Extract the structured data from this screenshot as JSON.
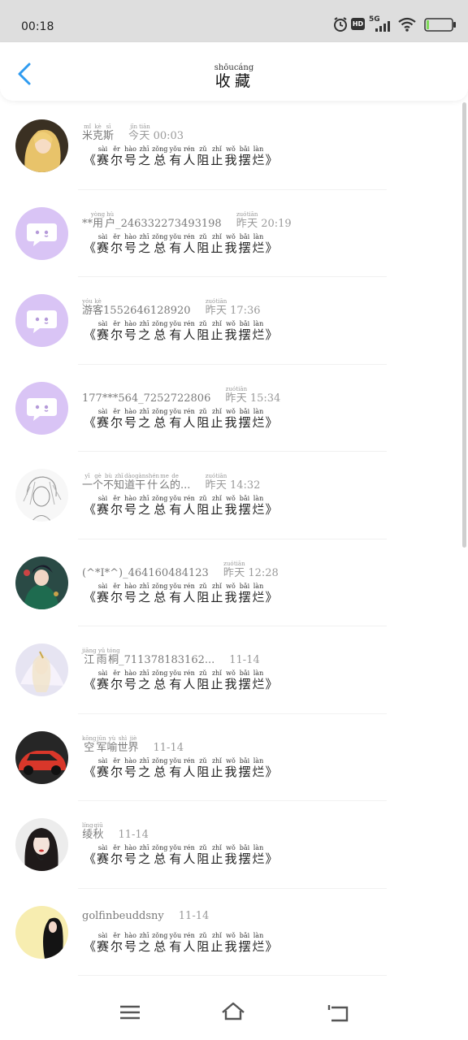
{
  "status_bar": {
    "time": "00:18",
    "icons": [
      "alarm-icon",
      "hd-icon",
      "signal-5g-icon",
      "wifi-icon",
      "battery-icon"
    ],
    "network": "5G",
    "hd": "HD"
  },
  "header": {
    "title_chars": [
      {
        "char": "收",
        "pinyin": "shōu"
      },
      {
        "char": "藏",
        "pinyin": "cáng"
      }
    ]
  },
  "book_title": {
    "open": "《",
    "close": "》",
    "chars": [
      {
        "char": "赛",
        "pinyin": "sài"
      },
      {
        "char": "尔",
        "pinyin": "ěr"
      },
      {
        "char": "号",
        "pinyin": "hào"
      },
      {
        "char": "之",
        "pinyin": "zhī"
      },
      {
        "char": "总",
        "pinyin": "zǒng"
      },
      {
        "char": "有",
        "pinyin": "yǒu"
      },
      {
        "char": "人",
        "pinyin": "rén"
      },
      {
        "char": "阻",
        "pinyin": "zǔ"
      },
      {
        "char": "止",
        "pinyin": "zhǐ"
      },
      {
        "char": "我",
        "pinyin": "wǒ"
      },
      {
        "char": "摆",
        "pinyin": "bǎi"
      },
      {
        "char": "烂",
        "pinyin": "làn"
      }
    ]
  },
  "items": [
    {
      "avatar": "blonde-girl",
      "name": [
        {
          "t": "米",
          "p": "mǐ"
        },
        {
          "t": "克",
          "p": "kè"
        },
        {
          "t": "斯",
          "p": "sī"
        }
      ],
      "time": [
        {
          "t": "今",
          "p": "jīn"
        },
        {
          "t": "天",
          "p": "tiān"
        },
        {
          "t": " 00:03",
          "p": ""
        }
      ]
    },
    {
      "avatar": "default",
      "name": [
        {
          "t": "**",
          "p": ""
        },
        {
          "t": "用",
          "p": "yòng"
        },
        {
          "t": "户",
          "p": "hù"
        },
        {
          "t": "_246332273493198",
          "p": ""
        }
      ],
      "time": [
        {
          "t": "昨",
          "p": "zuó"
        },
        {
          "t": "天",
          "p": "tiān"
        },
        {
          "t": " 20:19",
          "p": ""
        }
      ]
    },
    {
      "avatar": "default",
      "name": [
        {
          "t": "游",
          "p": "yóu"
        },
        {
          "t": "客",
          "p": "kè"
        },
        {
          "t": "1552646128920",
          "p": ""
        }
      ],
      "time": [
        {
          "t": "昨",
          "p": "zuó"
        },
        {
          "t": "天",
          "p": "tiān"
        },
        {
          "t": " 17:36",
          "p": ""
        }
      ]
    },
    {
      "avatar": "default",
      "name": [
        {
          "t": "177***564_7252722806",
          "p": ""
        }
      ],
      "time": [
        {
          "t": "昨",
          "p": "zuó"
        },
        {
          "t": "天",
          "p": "tiān"
        },
        {
          "t": " 15:34",
          "p": ""
        }
      ]
    },
    {
      "avatar": "sketch-boy",
      "name": [
        {
          "t": "一",
          "p": "yī"
        },
        {
          "t": "个",
          "p": "gè"
        },
        {
          "t": "不",
          "p": "bù"
        },
        {
          "t": "知",
          "p": "zhī"
        },
        {
          "t": "道",
          "p": "dào"
        },
        {
          "t": "干",
          "p": "gàn"
        },
        {
          "t": "什",
          "p": "shén"
        },
        {
          "t": "么",
          "p": "me"
        },
        {
          "t": "的",
          "p": "de"
        },
        {
          "t": "...",
          "p": ""
        }
      ],
      "time": [
        {
          "t": "昨",
          "p": "zuó"
        },
        {
          "t": "天",
          "p": "tiān"
        },
        {
          "t": " 14:32",
          "p": ""
        }
      ]
    },
    {
      "avatar": "green-warrior",
      "name": [
        {
          "t": "(^*I*^)_464160484123",
          "p": ""
        }
      ],
      "time": [
        {
          "t": "昨",
          "p": "zuó"
        },
        {
          "t": "天",
          "p": "tiān"
        },
        {
          "t": " 12:28",
          "p": ""
        }
      ]
    },
    {
      "avatar": "white-angel",
      "name": [
        {
          "t": "江",
          "p": "jiāng"
        },
        {
          "t": "雨",
          "p": "yǔ"
        },
        {
          "t": "桐",
          "p": "tóng"
        },
        {
          "t": "_711378183162...",
          "p": ""
        }
      ],
      "time": [
        {
          "t": "11-14",
          "p": ""
        }
      ]
    },
    {
      "avatar": "red-car",
      "name": [
        {
          "t": "空",
          "p": "kōng"
        },
        {
          "t": "军",
          "p": "jūn"
        },
        {
          "t": "喻",
          "p": "yù"
        },
        {
          "t": "世",
          "p": "shì"
        },
        {
          "t": "界",
          "p": "jiè"
        }
      ],
      "time": [
        {
          "t": "11-14",
          "p": ""
        }
      ]
    },
    {
      "avatar": "dark-hair-girl",
      "name": [
        {
          "t": "绫",
          "p": "líng"
        },
        {
          "t": "秋",
          "p": "qiū"
        }
      ],
      "time": [
        {
          "t": "11-14",
          "p": ""
        }
      ]
    },
    {
      "avatar": "yellow-silhouette",
      "name": [
        {
          "t": "golfinbeuddsny",
          "p": ""
        }
      ],
      "time": [
        {
          "t": "11-14",
          "p": ""
        }
      ]
    }
  ],
  "nav": {
    "icons": [
      "menu-icon",
      "home-icon",
      "back-icon"
    ]
  },
  "colors": {
    "accent": "#2f9bf0",
    "default_avatar_bg": "#d9c4f5",
    "status_bar_bg": "#dedede"
  }
}
